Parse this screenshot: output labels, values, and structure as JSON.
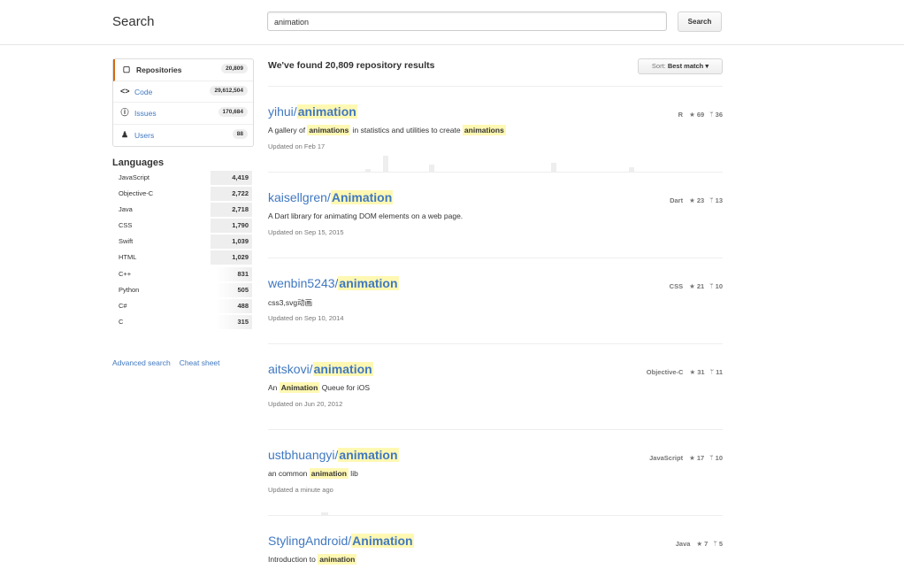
{
  "header": {
    "title": "Search",
    "search_value": "animation",
    "search_button": "Search"
  },
  "filters": [
    {
      "label": "Repositories",
      "count": "20,809",
      "icon": "repo-icon",
      "glyph": "▢"
    },
    {
      "label": "Code",
      "count": "29,612,504",
      "icon": "code-icon",
      "glyph": "<>"
    },
    {
      "label": "Issues",
      "count": "170,684",
      "icon": "issue-icon",
      "glyph": "ⓘ"
    },
    {
      "label": "Users",
      "count": "88",
      "icon": "person-icon",
      "glyph": "♟"
    }
  ],
  "languages": {
    "heading": "Languages",
    "items": [
      {
        "name": "JavaScript",
        "count": "4,419"
      },
      {
        "name": "Objective-C",
        "count": "2,722"
      },
      {
        "name": "Java",
        "count": "2,718"
      },
      {
        "name": "CSS",
        "count": "1,790"
      },
      {
        "name": "Swift",
        "count": "1,039"
      },
      {
        "name": "HTML",
        "count": "1,029"
      },
      {
        "name": "C++",
        "count": "831"
      },
      {
        "name": "Python",
        "count": "505"
      },
      {
        "name": "C#",
        "count": "488"
      },
      {
        "name": "C",
        "count": "315"
      }
    ]
  },
  "footer": {
    "advanced_search": "Advanced search",
    "cheat_sheet": "Cheat sheet"
  },
  "results": {
    "heading": "We've found 20,809 repository results",
    "sort_label": "Sort:",
    "sort_value": "Best match ▾",
    "items": [
      {
        "owner": "yihui/",
        "name": "animation",
        "lang": "R",
        "stars": "69",
        "forks": "36",
        "desc": [
          {
            "t": "A gallery of "
          },
          {
            "t": "animations",
            "hl": true
          },
          {
            "t": " in statistics and utilities to create "
          },
          {
            "t": "animations",
            "hl": true
          }
        ],
        "updated": "Updated on Feb 17"
      },
      {
        "owner": "kaisellgren/",
        "name": "Animation",
        "lang": "Dart",
        "stars": "23",
        "forks": "13",
        "desc": [
          {
            "t": "A Dart library for animating DOM elements on a web page."
          }
        ],
        "updated": "Updated on Sep 15, 2015"
      },
      {
        "owner": "wenbin5243/",
        "name": "animation",
        "lang": "CSS",
        "stars": "21",
        "forks": "10",
        "desc": [
          {
            "t": "css3,svg动画"
          }
        ],
        "updated": "Updated on Sep 10, 2014"
      },
      {
        "owner": "aitskovi/",
        "name": "animation",
        "lang": "Objective-C",
        "stars": "31",
        "forks": "11",
        "desc": [
          {
            "t": "An "
          },
          {
            "t": "Animation",
            "hl": true
          },
          {
            "t": " Queue for iOS"
          }
        ],
        "updated": "Updated on Jun 20, 2012"
      },
      {
        "owner": "ustbhuangyi/",
        "name": "animation",
        "lang": "JavaScript",
        "stars": "17",
        "forks": "10",
        "desc": [
          {
            "t": "an common "
          },
          {
            "t": "animation",
            "hl": true
          },
          {
            "t": " lib"
          }
        ],
        "updated": "Updated a minute ago"
      },
      {
        "owner": "StylingAndroid/",
        "name": "Animation",
        "lang": "Java",
        "stars": "7",
        "forks": "5",
        "desc": [
          {
            "t": "Introduction to "
          },
          {
            "t": "animation",
            "hl": true
          }
        ],
        "updated": ""
      }
    ]
  },
  "icons": {
    "star": "★",
    "fork": "ᛘ"
  },
  "colors": {
    "link": "#4078c0",
    "highlight": "#fff8b3",
    "selected_border": "#d26911"
  }
}
